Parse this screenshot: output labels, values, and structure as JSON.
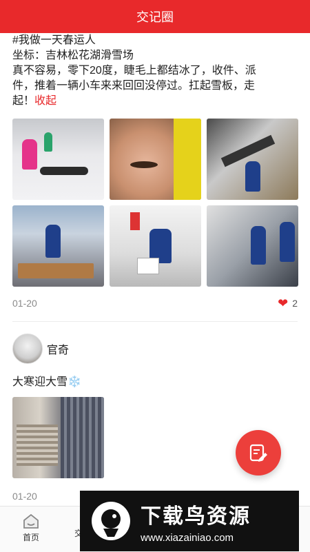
{
  "header": {
    "title": "交记圈"
  },
  "post1": {
    "text_lines": [
      "#我做一天春运人",
      "坐标：吉林松花湖滑雪场",
      "真不容易，零下20度，睫毛上都结冰了，收件、派",
      "件，推着一辆小车来来回回没停过。扛起雪板，走"
    ],
    "text_last": "起！",
    "collapse_label": "收起",
    "photos": [
      "photo-ski-slope",
      "photo-face-closeup",
      "photo-ski-rack",
      "photo-cart-street",
      "photo-packing",
      "photo-store-aisle"
    ],
    "date": "01-20",
    "like_count": "2"
  },
  "post2": {
    "username": "官奇",
    "text": "大寒迎大雪",
    "emoji": "❄️",
    "date": "01-20"
  },
  "fab": {
    "icon": "edit-note-icon"
  },
  "bottom_nav": {
    "home_label": "首页",
    "second_label_partial": "交"
  },
  "watermark": {
    "cn": "下载鸟资源",
    "url": "www.xiazainiao.com"
  },
  "colors": {
    "accent": "#e8292b",
    "fab": "#ec3f3b"
  }
}
